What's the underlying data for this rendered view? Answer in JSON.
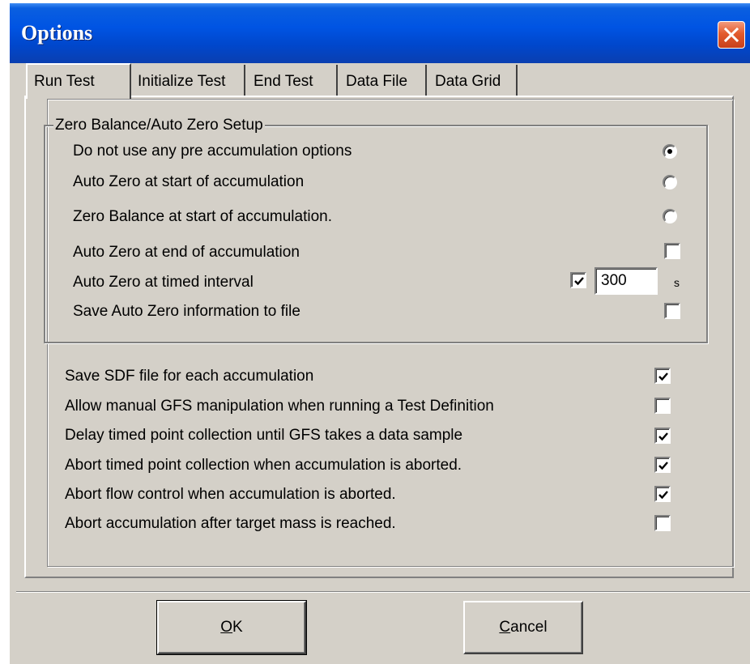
{
  "window": {
    "title": "Options"
  },
  "tabs": [
    {
      "label": "Run Test",
      "active": true
    },
    {
      "label": "Initialize Test",
      "active": false
    },
    {
      "label": "End Test",
      "active": false
    },
    {
      "label": "Data File",
      "active": false
    },
    {
      "label": "Data Grid",
      "active": false
    }
  ],
  "zero_group": {
    "legend": "Zero Balance/Auto Zero Setup",
    "radios": [
      {
        "label": "Do not use any pre accumulation options",
        "checked": true
      },
      {
        "label": "Auto Zero at start of accumulation",
        "checked": false
      },
      {
        "label": "Zero Balance at start of accumulation.",
        "checked": false
      }
    ],
    "end_accum": {
      "label": "Auto Zero at end of accumulation",
      "checked": false
    },
    "timed": {
      "label": "Auto Zero at timed interval",
      "checked": true,
      "value": "300",
      "unit": "s"
    },
    "save_info": {
      "label": "Save Auto Zero information to file",
      "checked": false
    }
  },
  "options": [
    {
      "label": "Save SDF file for each accumulation",
      "checked": true
    },
    {
      "label": "Allow manual GFS manipulation when running a Test Definition",
      "checked": false
    },
    {
      "label": "Delay timed point collection until GFS takes a data sample",
      "checked": true
    },
    {
      "label": "Abort timed point collection when accumulation is aborted.",
      "checked": true
    },
    {
      "label": "Abort flow control when accumulation is aborted.",
      "checked": true
    },
    {
      "label": "Abort accumulation after target mass is reached.",
      "checked": false
    }
  ],
  "buttons": {
    "ok": {
      "mnemonic": "O",
      "rest": "K"
    },
    "cancel": {
      "mnemonic": "C",
      "rest": "ancel"
    }
  },
  "colors": {
    "title_bar": "#0054e3",
    "dialog_face": "#d4d0c8",
    "close_button": "#e35b2d"
  }
}
